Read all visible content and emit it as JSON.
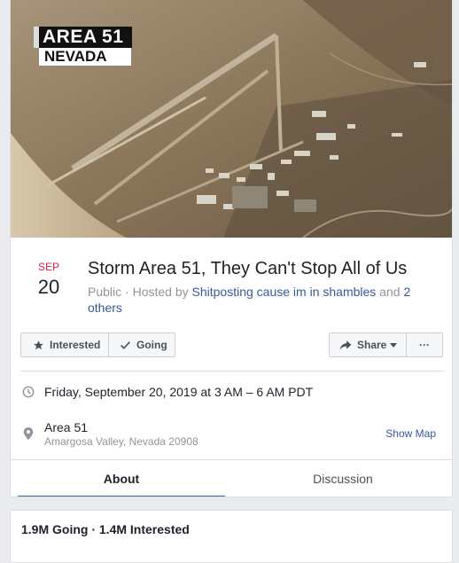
{
  "cover": {
    "badge_line1": "AREA 51",
    "badge_line2": "NEVADA"
  },
  "event": {
    "month": "SEP",
    "day": "20",
    "title": "Storm Area 51, They Can't Stop All of Us",
    "privacy": "Public",
    "hosted_prefix": " · Hosted by ",
    "host": "Shitposting cause im in shambles",
    "and_text": " and ",
    "others": "2 others"
  },
  "actions": {
    "interested": "Interested",
    "going": "Going",
    "share": "Share",
    "more": "···"
  },
  "details": {
    "when": "Friday, September 20, 2019 at 3 AM – 6 AM PDT",
    "location_name": "Area 51",
    "location_address": "Amargosa Valley, Nevada 20908",
    "show_map": "Show Map"
  },
  "tabs": [
    {
      "label": "About",
      "active": true
    },
    {
      "label": "Discussion",
      "active": false
    }
  ],
  "stats": {
    "summary": "1.9M Going · 1.4M Interested"
  },
  "icons": {
    "interested": "star-icon",
    "going": "check-icon",
    "share": "share-arrow-icon",
    "time": "clock-icon",
    "location": "map-pin-icon"
  },
  "colors": {
    "link": "#365899",
    "date_month": "#e41e3f",
    "tab_active": "#4267b2"
  }
}
